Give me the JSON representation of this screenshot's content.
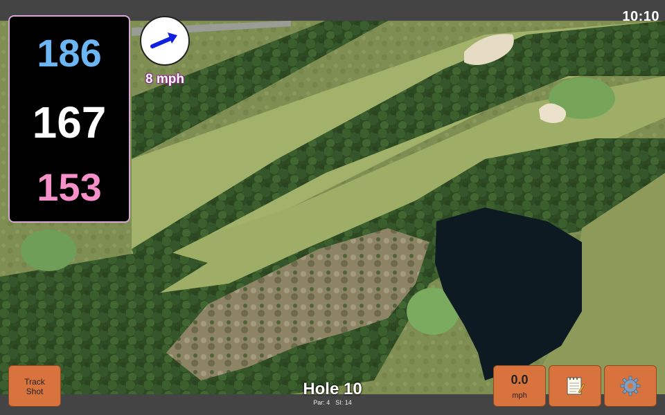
{
  "status_bar": {
    "time": "10:10"
  },
  "distances": {
    "back": "186",
    "middle": "167",
    "front": "153",
    "colors": {
      "back": "#6cb6f4",
      "middle": "#ffffff",
      "front": "#f590c8"
    }
  },
  "wind": {
    "speed_label": "8 mph",
    "icon": "wind-arrow-icon",
    "arrow_color": "#1020e0"
  },
  "buttons": {
    "track_shot": {
      "line1": "Track",
      "line2": "Shot"
    },
    "speed": {
      "value": "0.0",
      "unit": "mph"
    },
    "notes": {
      "icon": "notepad-icon"
    },
    "settings": {
      "icon": "gear-icon"
    },
    "accent_color": "#d9733d"
  },
  "hole": {
    "title": "Hole 10",
    "par_label": "Par: 4",
    "si_label": "SI: 14"
  }
}
